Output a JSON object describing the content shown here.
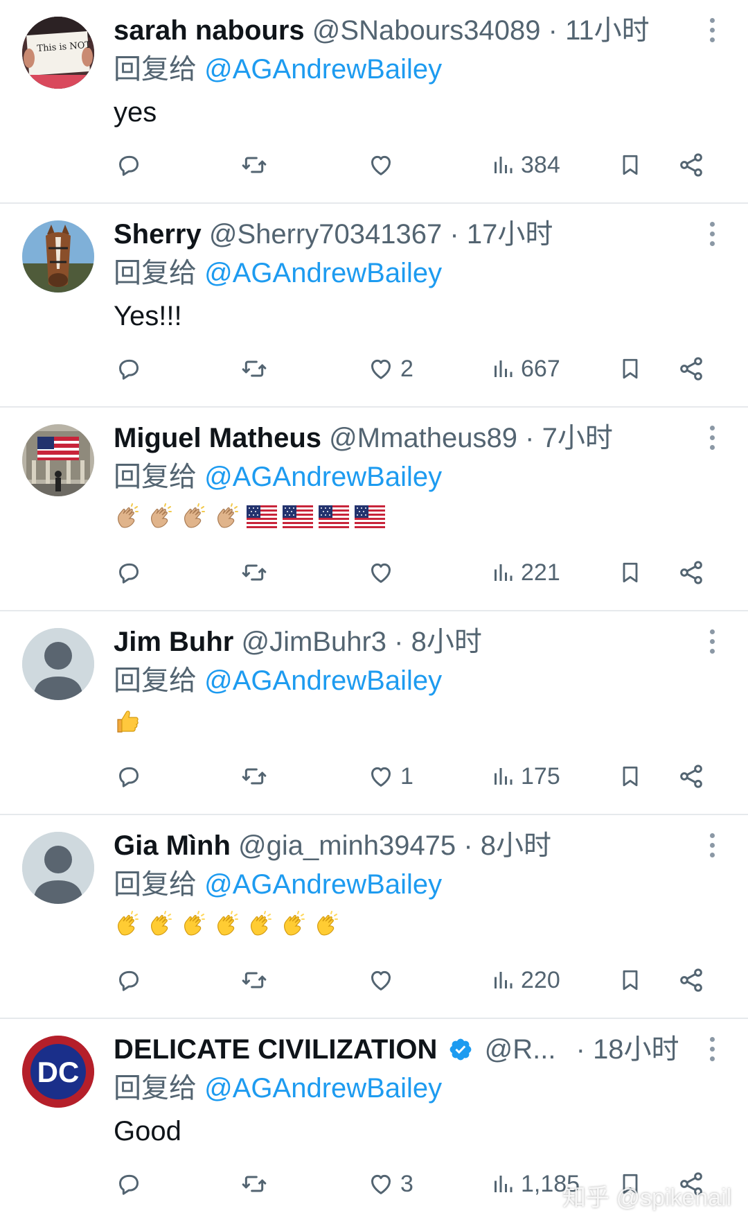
{
  "tweets": [
    {
      "name": "sarah nabours",
      "handle": "@SNabours34089",
      "dot": "·",
      "time": "11小时",
      "reply_prefix": "回复给",
      "reply_to": "@AGAndrewBailey",
      "text": "yes",
      "likes": "",
      "views": "384",
      "avatar_sign_text": "This is NOT Normal"
    },
    {
      "name": "Sherry",
      "handle": "@Sherry70341367",
      "dot": "·",
      "time": "17小时",
      "reply_prefix": "回复给",
      "reply_to": "@AGAndrewBailey",
      "text": "Yes!!!",
      "likes": "2",
      "views": "667"
    },
    {
      "name": "Miguel Matheus",
      "handle": "@Mmatheus89",
      "dot": "·",
      "time": "7小时",
      "reply_prefix": "回复给",
      "reply_to": "@AGAndrewBailey",
      "text": "",
      "emojis": [
        "clap-light",
        "clap-light",
        "clap-light",
        "clap-light",
        "us-flag",
        "us-flag",
        "us-flag",
        "us-flag"
      ],
      "likes": "",
      "views": "221"
    },
    {
      "name": "Jim Buhr",
      "handle": "@JimBuhr3",
      "dot": "·",
      "time": "8小时",
      "reply_prefix": "回复给",
      "reply_to": "@AGAndrewBailey",
      "text": "",
      "emojis": [
        "thumbs-up"
      ],
      "likes": "1",
      "views": "175"
    },
    {
      "name": "Gia Mình",
      "handle": "@gia_minh39475",
      "dot": "·",
      "time": "8小时",
      "reply_prefix": "回复给",
      "reply_to": "@AGAndrewBailey",
      "text": "",
      "emojis": [
        "clap-yellow",
        "clap-yellow",
        "clap-yellow",
        "clap-yellow",
        "clap-yellow",
        "clap-yellow",
        "clap-yellow"
      ],
      "likes": "",
      "views": "220"
    },
    {
      "name": "DELICATE CIVILIZATION",
      "handle": "@R...",
      "dot": "·",
      "time": "18小时",
      "reply_prefix": "回复给",
      "reply_to": "@AGAndrewBailey",
      "text": "Good",
      "likes": "3",
      "views": "1,185",
      "verified": true,
      "avatar_text": "DC"
    }
  ],
  "icons": {
    "reply": "reply-icon",
    "retweet": "retweet-icon",
    "like": "heart-icon",
    "views": "views-icon",
    "bookmark": "bookmark-icon",
    "share": "share-icon",
    "more": "more-icon"
  },
  "colors": {
    "link": "#1d9bf0",
    "muted": "#536471",
    "text": "#0f1419",
    "divider": "#e6e9ec"
  },
  "watermark": "知乎 @spikenail"
}
